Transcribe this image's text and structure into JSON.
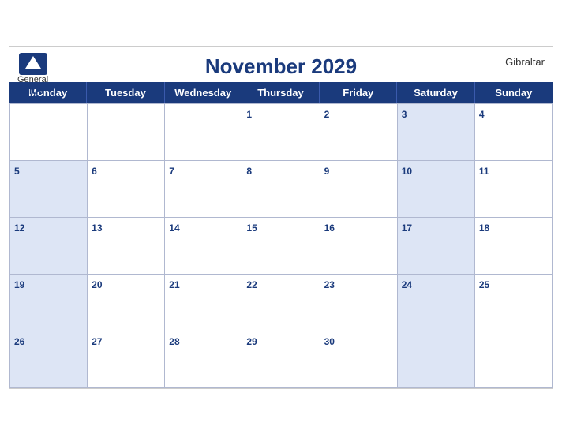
{
  "header": {
    "logo_general": "General",
    "logo_blue": "Blue",
    "title": "November 2029",
    "region": "Gibraltar"
  },
  "days": [
    "Monday",
    "Tuesday",
    "Wednesday",
    "Thursday",
    "Friday",
    "Saturday",
    "Sunday"
  ],
  "weeks": [
    [
      {
        "num": "",
        "empty": true,
        "shaded": false
      },
      {
        "num": "",
        "empty": true,
        "shaded": false
      },
      {
        "num": "",
        "empty": true,
        "shaded": false
      },
      {
        "num": "1",
        "empty": false,
        "shaded": false
      },
      {
        "num": "2",
        "empty": false,
        "shaded": false
      },
      {
        "num": "3",
        "empty": false,
        "shaded": true
      },
      {
        "num": "4",
        "empty": false,
        "shaded": false
      }
    ],
    [
      {
        "num": "5",
        "empty": false,
        "shaded": true
      },
      {
        "num": "6",
        "empty": false,
        "shaded": false
      },
      {
        "num": "7",
        "empty": false,
        "shaded": false
      },
      {
        "num": "8",
        "empty": false,
        "shaded": false
      },
      {
        "num": "9",
        "empty": false,
        "shaded": false
      },
      {
        "num": "10",
        "empty": false,
        "shaded": true
      },
      {
        "num": "11",
        "empty": false,
        "shaded": false
      }
    ],
    [
      {
        "num": "12",
        "empty": false,
        "shaded": true
      },
      {
        "num": "13",
        "empty": false,
        "shaded": false
      },
      {
        "num": "14",
        "empty": false,
        "shaded": false
      },
      {
        "num": "15",
        "empty": false,
        "shaded": false
      },
      {
        "num": "16",
        "empty": false,
        "shaded": false
      },
      {
        "num": "17",
        "empty": false,
        "shaded": true
      },
      {
        "num": "18",
        "empty": false,
        "shaded": false
      }
    ],
    [
      {
        "num": "19",
        "empty": false,
        "shaded": true
      },
      {
        "num": "20",
        "empty": false,
        "shaded": false
      },
      {
        "num": "21",
        "empty": false,
        "shaded": false
      },
      {
        "num": "22",
        "empty": false,
        "shaded": false
      },
      {
        "num": "23",
        "empty": false,
        "shaded": false
      },
      {
        "num": "24",
        "empty": false,
        "shaded": true
      },
      {
        "num": "25",
        "empty": false,
        "shaded": false
      }
    ],
    [
      {
        "num": "26",
        "empty": false,
        "shaded": true
      },
      {
        "num": "27",
        "empty": false,
        "shaded": false
      },
      {
        "num": "28",
        "empty": false,
        "shaded": false
      },
      {
        "num": "29",
        "empty": false,
        "shaded": false
      },
      {
        "num": "30",
        "empty": false,
        "shaded": false
      },
      {
        "num": "",
        "empty": true,
        "shaded": true
      },
      {
        "num": "",
        "empty": true,
        "shaded": false
      }
    ]
  ]
}
